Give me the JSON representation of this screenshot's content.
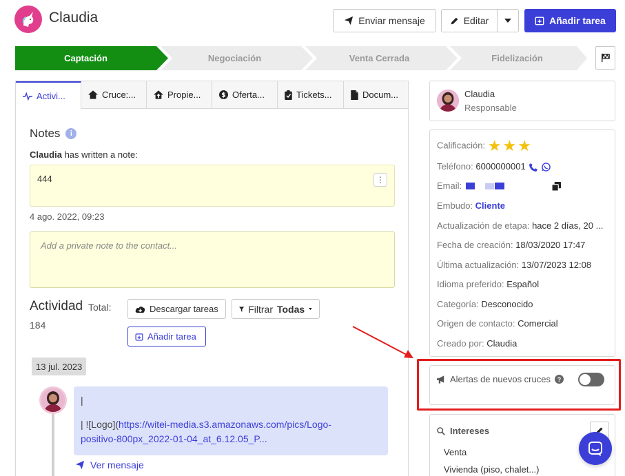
{
  "header": {
    "contact_name": "Claudia",
    "send_message": "Enviar mensaje",
    "edit": "Editar",
    "add_task": "Añadir tarea"
  },
  "pipeline": {
    "stages": [
      "Captación",
      "Negociación",
      "Venta Cerrada",
      "Fidelización"
    ],
    "active_color": "#138e13"
  },
  "tabs": [
    "Activi...",
    "Cruce:...",
    "Propie...",
    "Oferta...",
    "Tickets...",
    "Docum..."
  ],
  "notes": {
    "title": "Notes",
    "info_glyph": "i",
    "author": "Claudia",
    "author_suffix": " has written a note:",
    "text": "444",
    "menu_glyph": "⋮",
    "date": "4 ago. 2022, 09:23",
    "private_placeholder": "Add a private note to the contact..."
  },
  "activity": {
    "title": "Actividad",
    "total_label": "Total:",
    "total": "184",
    "download": "Descargar tareas",
    "filter_label": "Filtrar",
    "filter_value": "Todas",
    "add_task": "Añadir tarea",
    "date_chip": "13 jul. 2023",
    "message_line1": "|",
    "message_line2_prefix": "| ![Logo](",
    "message_link": "https://witei-media.s3.amazonaws.com/pics/Logo-",
    "message_line3": "positivo-800px_2022-01-04_at_6.12.05_P...",
    "see_message": "Ver mensaje"
  },
  "responsible": {
    "name": "Claudia",
    "role": "Responsable"
  },
  "details": {
    "rating_label": "Calificación:",
    "rating": 3,
    "phone_label": "Teléfono:",
    "phone": "6000000001",
    "email_label": "Email:",
    "funnel_label": "Embudo:",
    "funnel": "Cliente",
    "stage_update_label": "Actualización de etapa:",
    "stage_update": "hace 2 días, 20 ...",
    "created_label": "Fecha de creación:",
    "created": "18/03/2020 17:47",
    "updated_label": "Última actualización:",
    "updated": "13/07/2023 12:08",
    "language_label": "Idioma preferido:",
    "language": "Español",
    "category_label": "Categoría:",
    "category": "Desconocido",
    "origin_label": "Origen de contacto:",
    "origin": "Comercial",
    "creator_label": "Creado por:",
    "creator": "Claudia"
  },
  "alerts": {
    "label": "Alertas de nuevos cruces",
    "help_glyph": "?",
    "enabled": false
  },
  "interests": {
    "title": "Intereses",
    "items": [
      "Venta",
      "Vivienda (piso, chalet...)"
    ]
  },
  "colors": {
    "primary": "#3b3fd8",
    "highlight": "#e41c1c",
    "note_bg": "#ffffdd"
  }
}
